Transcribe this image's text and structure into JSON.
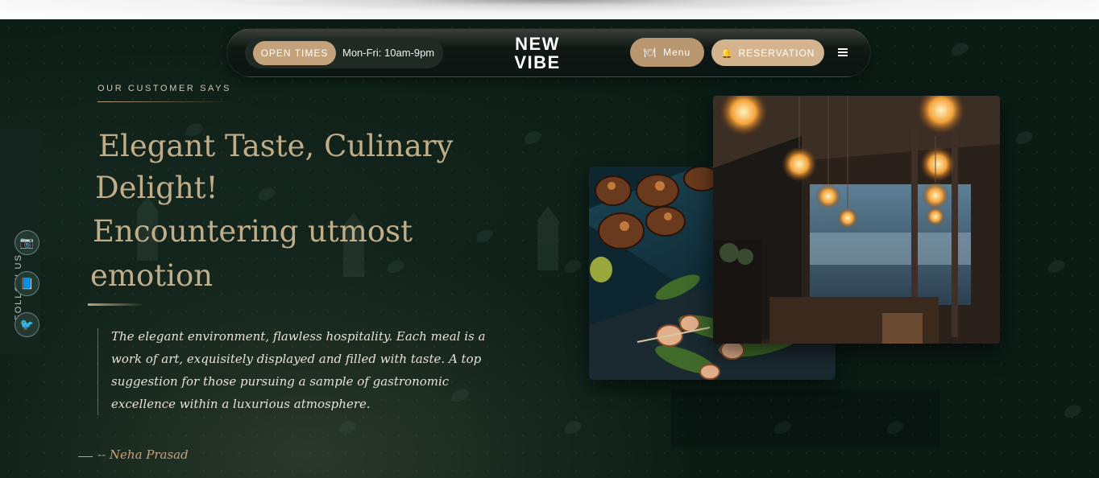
{
  "nav": {
    "open_label": "OPEN TIMES",
    "open_hours": "Mon-Fri: 10am-9pm",
    "logo_line1": "NEW",
    "logo_line2": "VIBE",
    "menu_label": "Menu",
    "menu_icon": "plate-icon",
    "reservation_label": "RESERVATION",
    "reservation_icon": "bell-icon",
    "hamburger_icon": "hamburger-icon"
  },
  "social": {
    "follow_label": "FOLLOW US",
    "items": [
      {
        "icon": "camera-icon",
        "glyph": "📷"
      },
      {
        "icon": "book-icon",
        "glyph": "📘"
      },
      {
        "icon": "bird-icon",
        "glyph": "🐦"
      }
    ]
  },
  "testimonial": {
    "eyebrow": "OUR CUSTOMER SAYS",
    "headline_line1": "Elegant Taste, Culinary",
    "headline_line2": "Delight!",
    "headline_line3": "Encountering utmost",
    "headline_line4": "emotion",
    "quote": "The elegant environment, flawless hospitality. Each meal is a work of art, exquisitely displayed and filled with taste. A top suggestion for those pursuing a sample of gastronomic excellence within a luxurious atmosphere.",
    "author": "-- Neha Prasad"
  },
  "colors": {
    "accent": "#c3a27c",
    "background": "#0b1c15",
    "headline": "#c2ad89"
  }
}
